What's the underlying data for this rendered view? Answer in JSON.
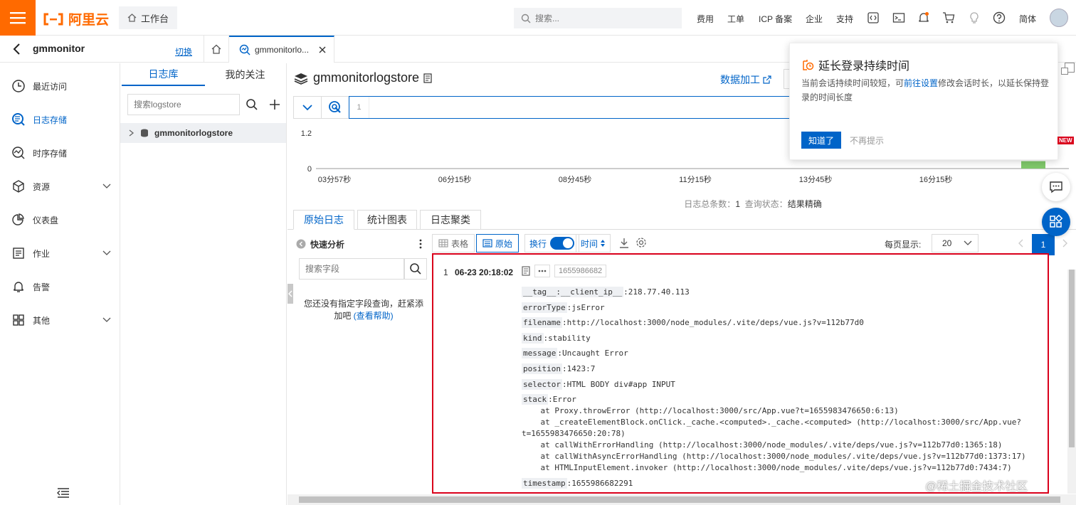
{
  "topbar": {
    "logo_text": "阿里云",
    "workbench": "工作台",
    "search_placeholder": "搜索...",
    "nav": [
      "费用",
      "工单",
      "ICP 备案",
      "企业",
      "支持"
    ],
    "lang": "简体"
  },
  "bar2": {
    "project": "gmmonitor",
    "switch": "切换",
    "tab_label": "gmmonitorlo..."
  },
  "leftnav": {
    "items": [
      {
        "label": "最近访问",
        "icon": "clock-icon"
      },
      {
        "label": "日志存储",
        "icon": "log-search-icon"
      },
      {
        "label": "时序存储",
        "icon": "metric-icon"
      },
      {
        "label": "资源",
        "icon": "cube-icon"
      },
      {
        "label": "仪表盘",
        "icon": "pie-icon"
      },
      {
        "label": "作业",
        "icon": "job-icon"
      },
      {
        "label": "告警",
        "icon": "bell-icon"
      },
      {
        "label": "其他",
        "icon": "grid-icon"
      }
    ]
  },
  "col2": {
    "tab_logstore": "日志库",
    "tab_follow": "我的关注",
    "search_placeholder": "搜索logstore",
    "logstore": "gmmonitorlogstore"
  },
  "main": {
    "title": "gmmonitorlogstore",
    "data_process": "数据加工",
    "query_line": "1",
    "status_count_label": "日志总条数：",
    "status_count": "1",
    "status_state_label": "查询状态：",
    "status_state": "结果精确",
    "tabs": [
      "原始日志",
      "统计图表",
      "日志聚类"
    ]
  },
  "chart_data": {
    "type": "bar",
    "x": [
      "03分57秒",
      "06分15秒",
      "08分45秒",
      "11分15秒",
      "13分45秒",
      "16分15秒",
      "1..."
    ],
    "y_ticks": [
      "1.2",
      "0"
    ],
    "ylim": [
      0,
      1.2
    ],
    "bars": [
      {
        "position": "end",
        "value": 1
      }
    ],
    "bar_color": "#7fc86a"
  },
  "quick": {
    "title": "快速分析",
    "search_placeholder": "搜索字段",
    "empty_text": "您还没有指定字段查询，赶紧添加吧",
    "help_link": "(查看帮助)"
  },
  "toolbar": {
    "table": "表格",
    "raw": "原始",
    "wrap": "换行",
    "time": "时间",
    "per_page_label": "每页显示:",
    "per_page": "20",
    "page": "1"
  },
  "log": {
    "index": "1",
    "time": "06-23 20:18:02",
    "timestamp_badge": "1655986682",
    "fields": [
      {
        "key": "__tag__:__client_ip__",
        "value": ":218.77.40.113"
      },
      {
        "key": "errorType",
        "value": ":jsError"
      },
      {
        "key": "filename",
        "value": ":http://localhost:3000/node_modules/.vite/deps/vue.js?v=112b77d0"
      },
      {
        "key": "kind",
        "value": ":stability"
      },
      {
        "key": "message",
        "value": ":Uncaught Error"
      },
      {
        "key": "position",
        "value": ":1423:7"
      },
      {
        "key": "selector",
        "value": ":HTML BODY div#app INPUT"
      },
      {
        "key": "stack",
        "value": ":Error"
      }
    ],
    "stack_lines": [
      "    at Proxy.throwError (http://localhost:3000/src/App.vue?t=1655983476650:6:13)",
      "    at _createElementBlock.onClick._cache.<computed>._cache.<computed> (http://localhost:3000/src/App.vue?",
      "t=1655983476650:20:78)",
      "    at callWithErrorHandling (http://localhost:3000/node_modules/.vite/deps/vue.js?v=112b77d0:1365:18)",
      "    at callWithAsyncErrorHandling (http://localhost:3000/node_modules/.vite/deps/vue.js?v=112b77d0:1373:17)",
      "    at HTMLInputElement.invoker (http://localhost:3000/node_modules/.vite/deps/vue.js?v=112b77d0:7434:7)"
    ],
    "last_field": {
      "key": "timestamp",
      "value": ":1655986682291"
    }
  },
  "popover": {
    "title": "延长登录持续时间",
    "desc_before": "当前会话持续时间较短，可",
    "desc_link": "前往设置",
    "desc_after": "修改会话时长，以延长保持登录的时间长度",
    "ok": "知道了",
    "no_remind": "不再提示"
  },
  "float": {
    "new_badge": "NEW"
  },
  "watermark": "@稀土掘金技术社区",
  "colors": {
    "brand": "#ff6a00",
    "primary": "#0064c8",
    "highlight_border": "#d9001b"
  }
}
